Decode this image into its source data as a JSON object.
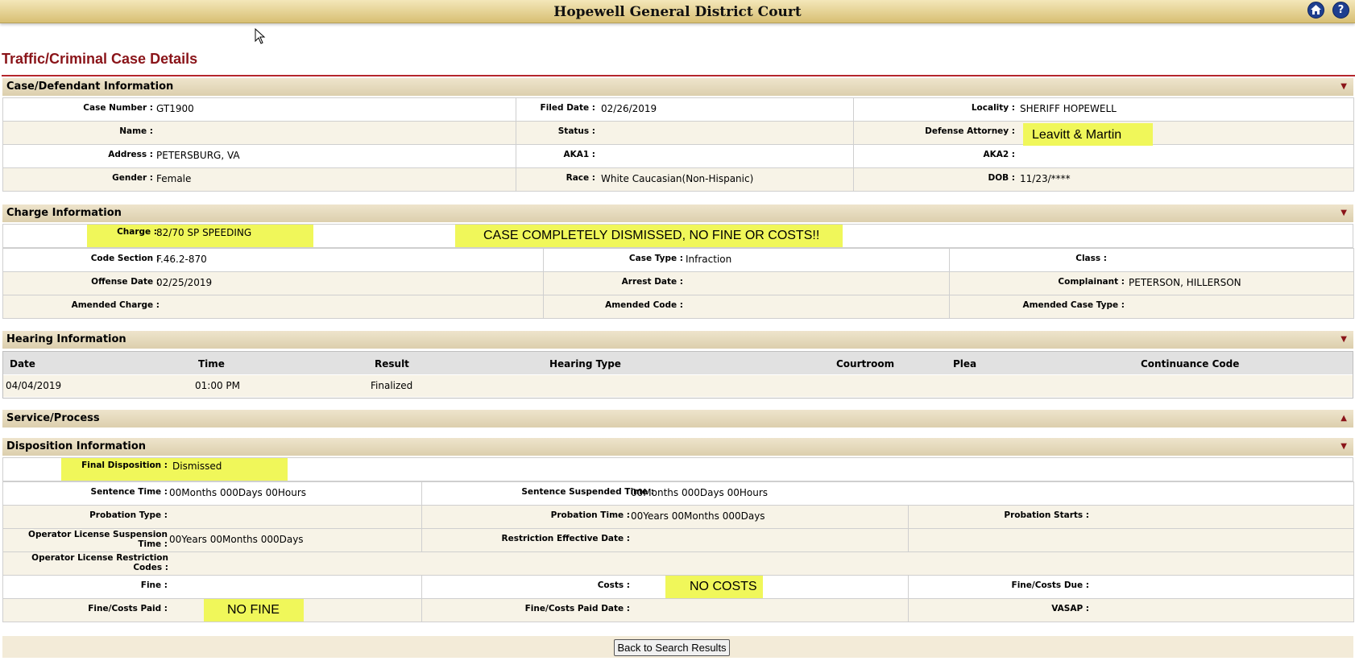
{
  "header": {
    "title": "Hopewell General District Court",
    "home_icon": "home-icon",
    "help_icon": "help-icon",
    "help_glyph": "?"
  },
  "page_title": "Traffic/Criminal Case Details",
  "case": {
    "section_title": "Case/Defendant Information",
    "case_number_label": "Case Number :",
    "case_number": "GT1900",
    "filed_date_label": "Filed Date :",
    "filed_date": "02/26/2019",
    "locality_label": "Locality :",
    "locality": "SHERIFF HOPEWELL",
    "name_label": "Name :",
    "name": "",
    "status_label": "Status :",
    "status": "",
    "defense_label": "Defense Attorney :",
    "defense_note": "Leavitt & Martin",
    "address_label": "Address :",
    "address": "PETERSBURG, VA",
    "aka1_label": "AKA1 :",
    "aka2_label": "AKA2 :",
    "gender_label": "Gender :",
    "gender": "Female",
    "race_label": "Race :",
    "race": "White Caucasian(Non-Hispanic)",
    "dob_label": "DOB :",
    "dob": "11/23/****"
  },
  "charge": {
    "section_title": "Charge Information",
    "charge_label": "Charge :",
    "charge": "82/70 SP SPEEDING",
    "banner_note": "CASE COMPLETELY DISMISSED, NO FINE OR COSTS!!",
    "code_section_label": "Code Section :",
    "code_section": "F.46.2-870",
    "case_type_label": "Case Type :",
    "case_type": "Infraction",
    "class_label": "Class :",
    "offense_date_label": "Offense Date :",
    "offense_date": "02/25/2019",
    "arrest_date_label": "Arrest Date :",
    "complainant_label": "Complainant :",
    "complainant": "PETERSON, HILLERSON",
    "amended_charge_label": "Amended Charge :",
    "amended_code_label": "Amended Code :",
    "amended_case_type_label": "Amended Case Type :"
  },
  "hearing": {
    "section_title": "Hearing Information",
    "columns": [
      "Date",
      "Time",
      "Result",
      "Hearing Type",
      "Courtroom",
      "Plea",
      "Continuance Code"
    ],
    "rows": [
      {
        "date": "04/04/2019",
        "time": "01:00 PM",
        "result": "Finalized"
      }
    ]
  },
  "service": {
    "section_title": "Service/Process"
  },
  "disposition": {
    "section_title": "Disposition Information",
    "final_label": "Final Disposition :",
    "final": "Dismissed",
    "sentence_time_label": "Sentence Time :",
    "sentence_time": "00Months 000Days 00Hours",
    "sentence_susp_label": "Sentence Suspended Time :",
    "sentence_susp": "00Months 000Days 00Hours",
    "probation_type_label": "Probation Type :",
    "probation_time_label": "Probation Time :",
    "probation_time": "00Years 00Months 000Days",
    "probation_starts_label": "Probation Starts :",
    "ols_time_label_1": "Operator License Suspension",
    "ols_time_label_2": "Time :",
    "ols_time": "00Years 00Months 000Days",
    "restriction_label": "Restriction Effective Date :",
    "olr_codes_label_1": "Operator License Restriction",
    "olr_codes_label_2": "Codes :",
    "fine_label": "Fine :",
    "costs_label": "Costs :",
    "costs_note": "NO COSTS",
    "fine_due_label": "Fine/Costs Due :",
    "fine_paid_label": "Fine/Costs Paid :",
    "fine_paid_note": "NO FINE",
    "paid_date_label": "Fine/Costs Paid Date :",
    "vasap_label": "VASAP :"
  },
  "back_button": "Back to Search Results",
  "colors": {
    "accent": "#8a1419",
    "highlight": "#f0f75a",
    "header_band": "#dccfad"
  }
}
